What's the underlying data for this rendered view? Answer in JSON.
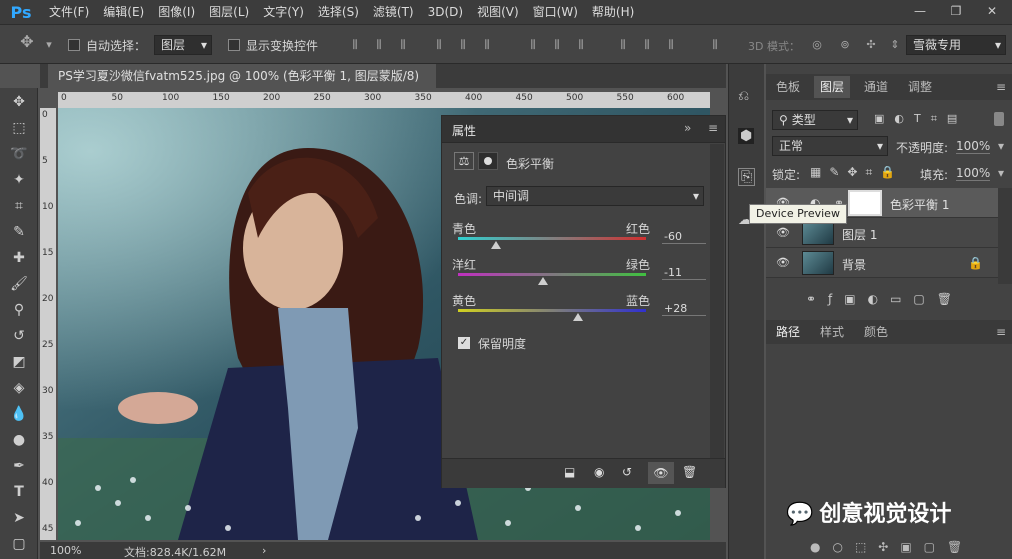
{
  "app": {
    "logo": "Ps"
  },
  "menu": {
    "items": [
      "文件(F)",
      "编辑(E)",
      "图像(I)",
      "图层(L)",
      "文字(Y)",
      "选择(S)",
      "滤镜(T)",
      "3D(D)",
      "视图(V)",
      "窗口(W)",
      "帮助(H)"
    ]
  },
  "window_controls": {
    "minimize": "—",
    "restore": "❐",
    "close": "✕"
  },
  "options": {
    "auto_select_label": "自动选择：",
    "auto_select_value": "图层",
    "show_transform_label": "显示变换控件",
    "mode3d_label": "3D 模式：",
    "workspace_value": "雪薇专用"
  },
  "document": {
    "tab_title": "PS学习夏沙微信fvatm525.jpg @ 100% (色彩平衡 1, 图层蒙版/8) *",
    "zoom": "100%",
    "doc_size": "文档:828.4K/1.62M",
    "ruler_ticks": [
      "0",
      "50",
      "100",
      "150",
      "200",
      "250",
      "300",
      "350",
      "400",
      "450",
      "500",
      "550",
      "600"
    ],
    "ruler_v_ticks": [
      "0",
      "5",
      "10",
      "15",
      "20",
      "25",
      "30",
      "35",
      "40",
      "45"
    ]
  },
  "properties": {
    "tab_label": "属性",
    "panel_title": "色彩平衡",
    "tone_label": "色调:",
    "tone_value": "中间调",
    "sliders": [
      {
        "left": "青色",
        "right": "红色",
        "value": "-60",
        "fraction": 0.2,
        "color_left": "#31d0d0",
        "color_right": "#d03030"
      },
      {
        "left": "洋红",
        "right": "绿色",
        "value": "-11",
        "fraction": 0.45,
        "color_left": "#c030c0",
        "color_right": "#40c040"
      },
      {
        "left": "黄色",
        "right": "蓝色",
        "value": "+28",
        "fraction": 0.64,
        "color_left": "#d0d020",
        "color_right": "#3030d0"
      }
    ],
    "preserve_luminosity_label": "保留明度"
  },
  "tooltip": {
    "text": "Device Preview"
  },
  "layers_panel": {
    "tabs": [
      "色板",
      "图层",
      "通道",
      "调整"
    ],
    "active_tab": "图层",
    "filter_value": "类型",
    "blend_mode": "正常",
    "opacity_label": "不透明度:",
    "opacity_value": "100%",
    "lock_label": "锁定:",
    "fill_label": "填充:",
    "fill_value": "100%",
    "layers": [
      {
        "name": "色彩平衡 1",
        "type": "adjustment"
      },
      {
        "name": "图层 1",
        "type": "pixel"
      },
      {
        "name": "背景",
        "type": "background"
      }
    ]
  },
  "bottom_panel": {
    "tabs": [
      "路径",
      "样式",
      "颜色"
    ]
  },
  "watermark": {
    "text": "创意视觉设计"
  }
}
